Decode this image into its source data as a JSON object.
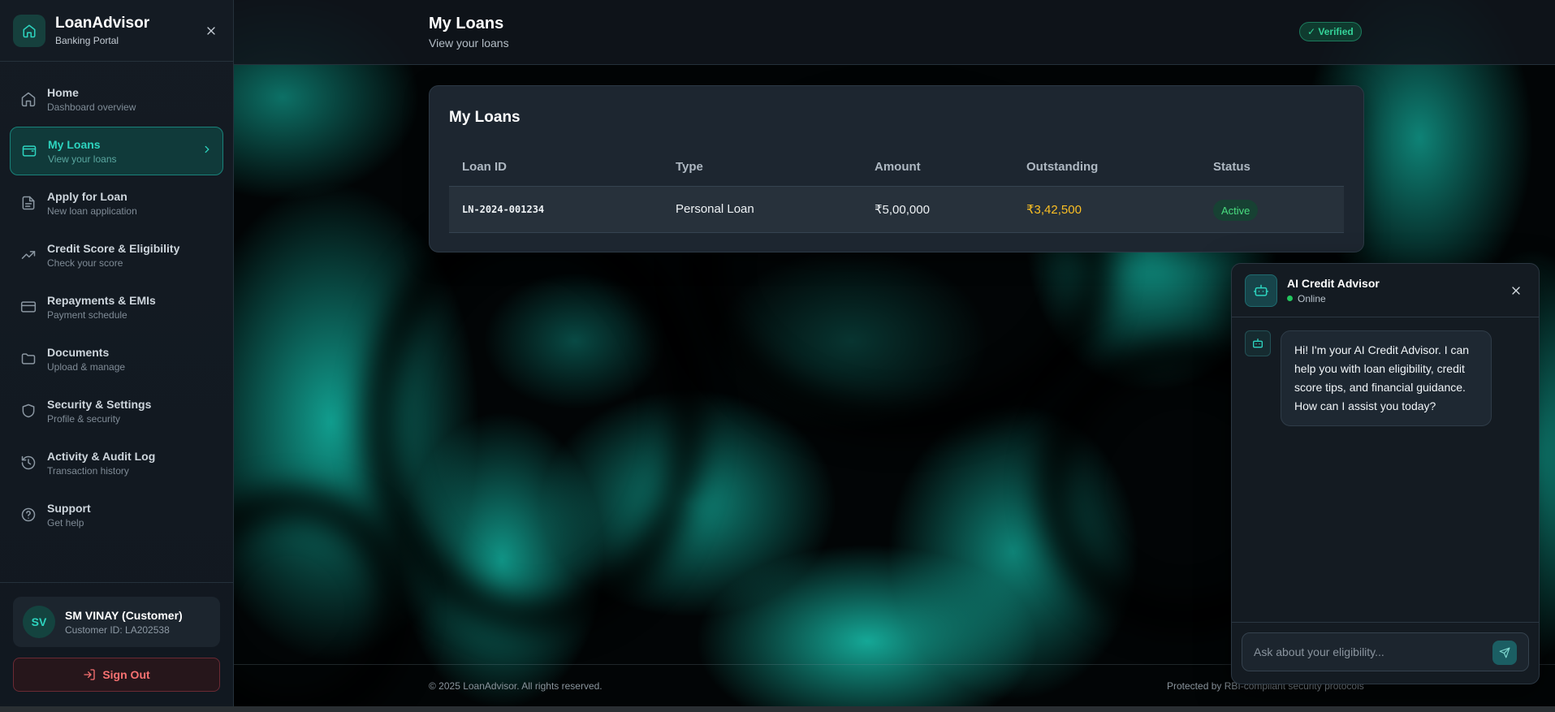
{
  "brand": {
    "title": "LoanAdvisor",
    "subtitle": "Banking Portal",
    "logo_icon": "home-icon"
  },
  "nav": [
    {
      "label": "Home",
      "sub": "Dashboard overview",
      "icon": "home-icon"
    },
    {
      "label": "My Loans",
      "sub": "View your loans",
      "icon": "wallet-icon",
      "active": true
    },
    {
      "label": "Apply for Loan",
      "sub": "New loan application",
      "icon": "document-icon"
    },
    {
      "label": "Credit Score & Eligibility",
      "sub": "Check your score",
      "icon": "trending-up-icon"
    },
    {
      "label": "Repayments & EMIs",
      "sub": "Payment schedule",
      "icon": "credit-card-icon"
    },
    {
      "label": "Documents",
      "sub": "Upload & manage",
      "icon": "folder-icon"
    },
    {
      "label": "Security & Settings",
      "sub": "Profile & security",
      "icon": "shield-icon"
    },
    {
      "label": "Activity & Audit Log",
      "sub": "Transaction history",
      "icon": "history-icon"
    },
    {
      "label": "Support",
      "sub": "Get help",
      "icon": "help-circle-icon"
    }
  ],
  "user": {
    "initials": "SV",
    "name": "SM VINAY (Customer)",
    "customer_id": "Customer ID: LA202538"
  },
  "signout_label": "Sign Out",
  "header": {
    "title": "My Loans",
    "subtitle": "View your loans",
    "verified": "✓ Verified"
  },
  "loans_card": {
    "title": "My Loans",
    "columns": [
      "Loan ID",
      "Type",
      "Amount",
      "Outstanding",
      "Status"
    ],
    "rows": [
      {
        "loan_id": "LN-2024-001234",
        "type": "Personal Loan",
        "amount": "₹5,00,000",
        "outstanding": "₹3,42,500",
        "status": "Active"
      }
    ]
  },
  "footer": {
    "left": "© 2025 LoanAdvisor. All rights reserved.",
    "right": "Protected by RBI-compliant security protocols"
  },
  "chat": {
    "title": "AI Credit Advisor",
    "status": "Online",
    "messages": [
      {
        "from": "bot",
        "text": "Hi! I'm your AI Credit Advisor. I can help you with loan eligibility, credit score tips, and financial guidance. How can I assist you today?"
      }
    ],
    "input_placeholder": "Ask about your eligibility..."
  },
  "colors": {
    "accent": "#2dd4bf",
    "danger": "#f87171",
    "warning": "#fbbf24",
    "success": "#4ade80"
  }
}
